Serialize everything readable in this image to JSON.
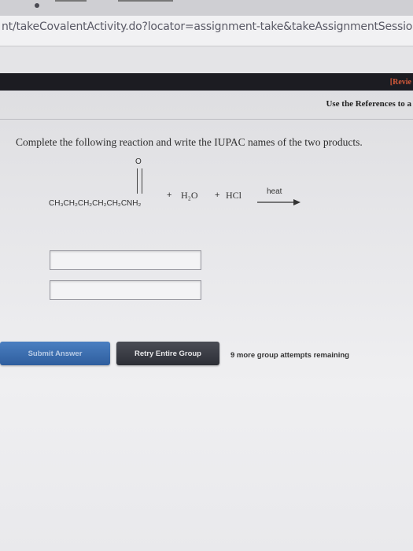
{
  "browser": {
    "url_fragment": "nt/takeCovalentActivity.do?locator=assignment-take&takeAssignmentSessio"
  },
  "header": {
    "review_link": "[Revie",
    "references_note": "Use the References to a"
  },
  "question": {
    "instruction": "Complete the following reaction and write the IUPAC names of the two products.",
    "reaction": {
      "reactant_formula": "CH₃CH₂CH₂CH₂CH₂CNH₂",
      "carbonyl_oxygen": "O",
      "plus_1": "+",
      "reagent_1": "H₂O",
      "plus_2": "+",
      "reagent_2": "HCl",
      "condition": "heat"
    },
    "answer_fields": [
      {
        "value": ""
      },
      {
        "value": ""
      }
    ]
  },
  "actions": {
    "submit_label": "Submit Answer",
    "retry_label": "Retry Entire Group",
    "attempts_text": "9 more group attempts remaining"
  }
}
